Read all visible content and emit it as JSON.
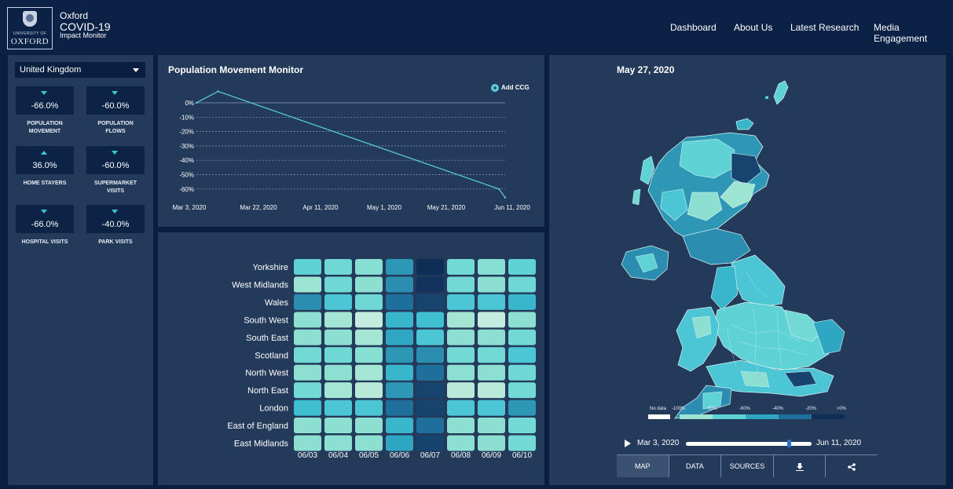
{
  "header": {
    "logo_line1": "UNIVERSITY OF",
    "logo_line2": "OXFORD",
    "brand_line1": "Oxford",
    "brand_line2": "COVID-19",
    "brand_line3": "Impact Monitor",
    "nav": [
      "Dashboard",
      "About Us",
      "Latest Research",
      "Media Engagement"
    ]
  },
  "sidebar": {
    "country": "United Kingdom",
    "stats": [
      {
        "value": "-66.0%",
        "label_lines": [
          "POPULATION",
          "MOVEMENT"
        ],
        "direction": "down"
      },
      {
        "value": "-60.0%",
        "label_lines": [
          "POPULATION",
          "FLOWS"
        ],
        "direction": "down"
      },
      {
        "value": "36.0%",
        "label_lines": [
          "HOME STAYERS"
        ],
        "direction": "up"
      },
      {
        "value": "-60.0%",
        "label_lines": [
          "SUPERMARKET",
          "VISITS"
        ],
        "direction": "down"
      },
      {
        "value": "-66.0%",
        "label_lines": [
          "HOSPITAL VISITS"
        ],
        "direction": "down"
      },
      {
        "value": "-40.0%",
        "label_lines": [
          "PARK VISITS"
        ],
        "direction": "down"
      }
    ]
  },
  "line_panel": {
    "title": "Population Movement Monitor",
    "add_label": "Add CCG"
  },
  "map_panel": {
    "date": "May 27, 2020",
    "legend": [
      "No data",
      "-100%",
      "-80%",
      "-60%",
      "-40%",
      "-20%",
      ">0%"
    ],
    "slider_start": "Mar 3, 2020",
    "slider_end": "Jun 11, 2020",
    "slider_position": 0.82,
    "tabs": [
      "MAP",
      "DATA",
      "SOURCES"
    ],
    "download_icon": "download-icon",
    "share_icon": "share-icon"
  },
  "colors": {
    "background": "#0a1f3f",
    "panel": "#233a5a",
    "accent": "#39c7cf",
    "line": "#57c9d6"
  },
  "chart_data": [
    {
      "type": "line",
      "title": "",
      "xlabel": "",
      "ylabel": "",
      "x_ticks": [
        "Mar 3, 2020",
        "Mar 22, 2020",
        "Apr 11, 2020",
        "May 1, 2020",
        "May 21, 2020",
        "Jun 11, 2020"
      ],
      "y_ticks": [
        "0%",
        "-10%",
        "-20%",
        "-30%",
        "-40%",
        "-50%",
        "-60%"
      ],
      "ylim": [
        -65,
        8
      ],
      "grid": true,
      "series": [
        {
          "x": [
            "2020-03-03",
            "2020-03-10",
            "2020-06-09",
            "2020-06-11"
          ],
          "values": [
            0,
            8,
            -60,
            -66
          ]
        }
      ]
    },
    {
      "type": "heatmap",
      "title": "",
      "rows": [
        "Yorkshire",
        "West Midlands",
        "Wales",
        "South West",
        "South East",
        "Scotland",
        "North West",
        "North East",
        "London",
        "East of England",
        "East Midlands"
      ],
      "columns": [
        "06/03",
        "06/04",
        "06/05",
        "06/06",
        "06/07",
        "06/08",
        "06/09",
        "06/10"
      ],
      "colors": [
        [
          "#5fd2d6",
          "#6fd8d4",
          "#86dfd2",
          "#2f97b6",
          "#0f2e55",
          "#72d9d4",
          "#86dfd2",
          "#5fd2d6"
        ],
        [
          "#9ee4d3",
          "#6fd8d4",
          "#8ddfd1",
          "#2b8eb0",
          "#13325d",
          "#72d9d4",
          "#8ddfd1",
          "#6fd8d4"
        ],
        [
          "#2b8eb0",
          "#4cc6d4",
          "#6fd8d4",
          "#1f6f9c",
          "#16446f",
          "#4cc6d4",
          "#4cc6d4",
          "#39b6cc"
        ],
        [
          "#8ddfd1",
          "#a4e5d3",
          "#c4ecdf",
          "#39b6cc",
          "#3fbfd0",
          "#a4e5d3",
          "#c4ecdf",
          "#8ddfd1"
        ],
        [
          "#8ddfd1",
          "#8ddfd1",
          "#a4e5d3",
          "#2fa7c2",
          "#4cc6d4",
          "#8ddfd1",
          "#8ddfd1",
          "#72d9d4"
        ],
        [
          "#72d9d4",
          "#6fd8d4",
          "#86dfd2",
          "#2f97b6",
          "#2b8eb0",
          "#72d9d4",
          "#72d9d4",
          "#4cc6d4"
        ],
        [
          "#8ddfd1",
          "#8ddfd1",
          "#a4e5d3",
          "#39b6cc",
          "#1f6f9c",
          "#8ddfd1",
          "#8ddfd1",
          "#6fd8d4"
        ],
        [
          "#72d9d4",
          "#a4e5d3",
          "#b8e9d9",
          "#2f97b6",
          "#16446f",
          "#b8e9d9",
          "#b8e9d9",
          "#72d9d4"
        ],
        [
          "#3fbfd0",
          "#4cc6d4",
          "#4cc6d4",
          "#1f6f9c",
          "#16446f",
          "#4cc6d4",
          "#4cc6d4",
          "#2f97b6"
        ],
        [
          "#8ddfd1",
          "#8ddfd1",
          "#8ddfd1",
          "#39b6cc",
          "#1f6f9c",
          "#8ddfd1",
          "#8ddfd1",
          "#72d9d4"
        ],
        [
          "#8ddfd1",
          "#8ddfd1",
          "#8ddfd1",
          "#2fa7c2",
          "#16446f",
          "#8ddfd1",
          "#8ddfd1",
          "#72d9d4"
        ]
      ]
    }
  ]
}
